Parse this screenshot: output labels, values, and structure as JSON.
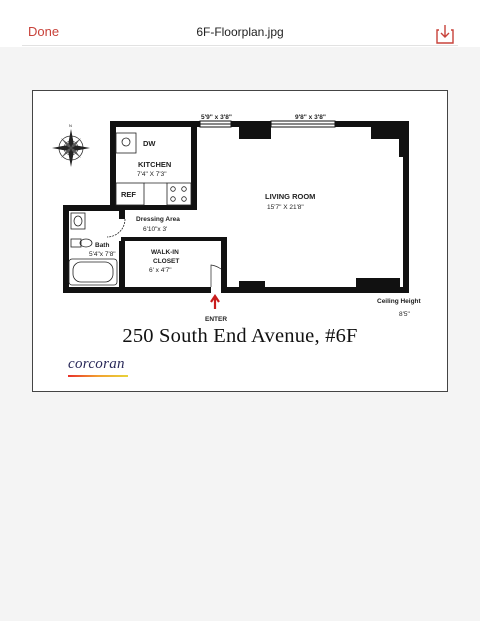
{
  "toolbar": {
    "done_label": "Done",
    "file_name": "6F-Floorplan.jpg",
    "download_icon": "download-icon",
    "accent_color": "#c8423a"
  },
  "floorplan": {
    "window_dims_left": "5'9\" x 3'8\"",
    "window_dims_right": "9'8\" x 3'8\"",
    "dw": "DW",
    "kitchen_name": "KITCHEN",
    "kitchen_dims": "7'4\" X 7'3\"",
    "ref": "REF",
    "living_name": "LIVING ROOM",
    "living_dims": "15'7\" X 21'8\"",
    "dressing_name": "Dressing Area",
    "dressing_dims": "6'10\"x 3'",
    "bath_name": "Bath",
    "bath_dims": "5'4\"x 7'8\"",
    "closet_line1": "WALK-IN",
    "closet_line2": "CLOSET",
    "closet_dims": "6' x 4'7\"",
    "enter": "ENTER",
    "ceiling_label": "Ceiling Height",
    "ceiling_value": "8'5\"",
    "compass_icon": "compass-rose-icon",
    "address": "250 South End Avenue, #6F",
    "brand": "corcoran"
  }
}
